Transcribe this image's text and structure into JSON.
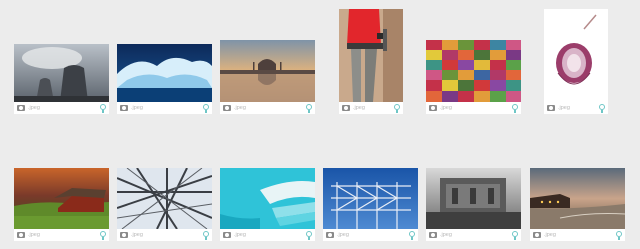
{
  "gallery": {
    "items": [
      {
        "id": "cooling-towers",
        "ext": ".jpeg"
      },
      {
        "id": "iceberg",
        "ext": ".jpeg"
      },
      {
        "id": "taj-mahal",
        "ext": ".jpeg"
      },
      {
        "id": "construction-worker",
        "ext": ".jpeg"
      },
      {
        "id": "knitted-fabric",
        "ext": ".jpeg"
      },
      {
        "id": "red-onion",
        "ext": ".jpeg"
      },
      {
        "id": "red-barn",
        "ext": ".jpeg"
      },
      {
        "id": "steel-structure",
        "ext": ".jpeg"
      },
      {
        "id": "pool-steps",
        "ext": ".jpeg"
      },
      {
        "id": "power-lines",
        "ext": ".jpeg"
      },
      {
        "id": "fortress",
        "ext": ".jpeg"
      },
      {
        "id": "beach-sunset",
        "ext": ".jpeg"
      }
    ],
    "icons": {
      "left": "camera-icon",
      "right": "lightbulb-icon"
    }
  }
}
